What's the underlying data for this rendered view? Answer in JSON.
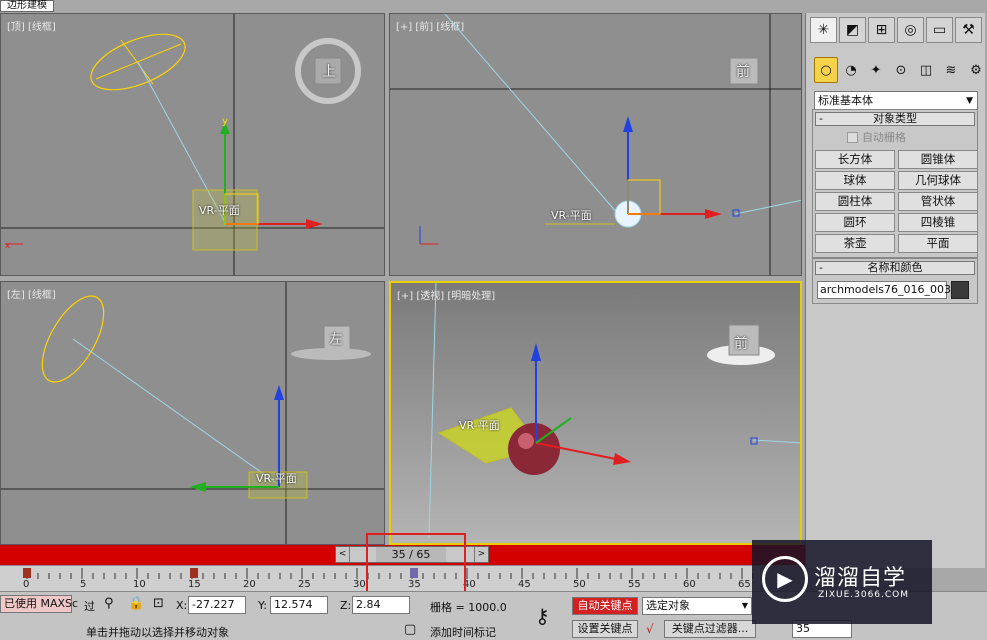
{
  "window": {
    "title_tab": "边形建模"
  },
  "viewports": {
    "top": {
      "label": "[顶] [线框]",
      "cube_label": "上",
      "object_label": "VR-平面"
    },
    "front": {
      "label": "[+] [前] [线框]",
      "cube_label": "前",
      "object_label": "VR-平面"
    },
    "left": {
      "label": "[左] [线框]",
      "cube_label": "左",
      "object_label": "VR-平面"
    },
    "persp": {
      "label": "[+] [透视] [明暗处理]",
      "cube_label": "前",
      "object_label": "VR-平面"
    }
  },
  "command_panel": {
    "tabs": [
      "create-icon",
      "modify-icon",
      "hierarchy-icon",
      "motion-icon",
      "display-icon",
      "utilities-icon"
    ],
    "dropdown_value": "标准基本体",
    "object_type": {
      "title": "对象类型",
      "autogrid": "自动栅格",
      "buttons": [
        "长方体",
        "圆锥体",
        "球体",
        "几何球体",
        "圆柱体",
        "管状体",
        "圆环",
        "四棱锥",
        "茶壶",
        "平面"
      ]
    },
    "name_color": {
      "title": "名称和颜色",
      "name_value": "archmodels76_016_003",
      "color": "#3a3a3a"
    }
  },
  "timeline": {
    "slider_value": "35 / 65",
    "prev": "<",
    "next": ">",
    "ticks": [
      "0",
      "5",
      "10",
      "15",
      "20",
      "25",
      "30",
      "35",
      "40",
      "45",
      "50",
      "55",
      "60",
      "65"
    ]
  },
  "status": {
    "script_label": "已使用 MAXSc",
    "prompt": "单击并拖动以选择并移动对象",
    "x_label": "X:",
    "x_value": "-27.227",
    "y_label": "Y:",
    "y_value": "12.574",
    "z_label": "Z:",
    "z_value": "2.84",
    "grid": "栅格 = 1000.0",
    "add_time_tag": "添加时间标记",
    "auto_key": "自动关键点",
    "set_key": "设置关键点",
    "selection_dropdown": "选定对象",
    "key_filters": "关键点过滤器...",
    "frame_value": "35",
    "filter_label": "过"
  },
  "watermark": {
    "title": "溜溜自学",
    "url": "ZIXUE.3066.COM"
  }
}
